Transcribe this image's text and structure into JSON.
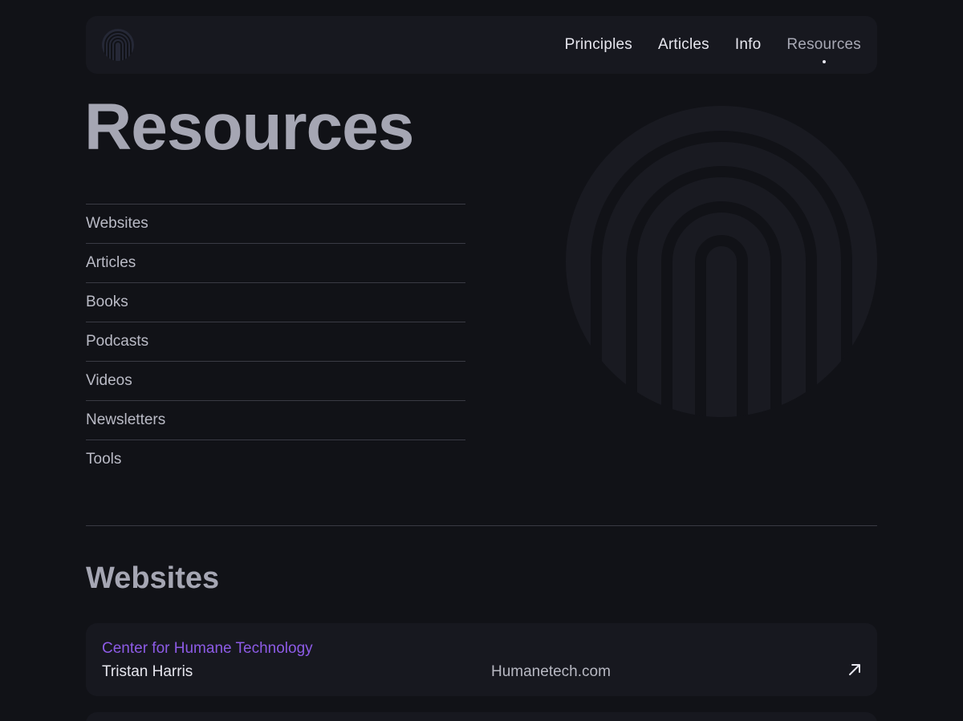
{
  "nav": {
    "logo_icon": "fingerprint-arch-icon",
    "links": [
      {
        "label": "Principles",
        "active": false
      },
      {
        "label": "Articles",
        "active": false
      },
      {
        "label": "Info",
        "active": false
      },
      {
        "label": "Resources",
        "active": true
      }
    ]
  },
  "hero": {
    "title": "Resources",
    "emblem_icon": "fingerprint-arch-icon"
  },
  "toc": {
    "items": [
      "Websites",
      "Articles",
      "Books",
      "Podcasts",
      "Videos",
      "Newsletters",
      "Tools"
    ]
  },
  "sections": {
    "websites": {
      "title": "Websites",
      "cards": [
        {
          "name": "Center for Humane Technology",
          "author": "Tristan Harris",
          "domain": "Humanetech.com",
          "link_icon": "arrow-up-right-icon"
        }
      ]
    }
  },
  "colors": {
    "background": "#111217",
    "surface": "#17181f",
    "accent": "#8d5be6",
    "heading": "#a5a6b3",
    "text": "#e6e6ee"
  }
}
